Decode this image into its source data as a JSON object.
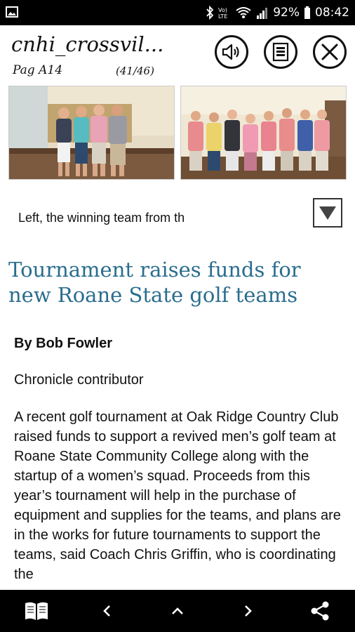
{
  "status_bar": {
    "battery": "92%",
    "time": "08:42",
    "icons": [
      "image-icon",
      "bluetooth-icon",
      "volte-icon",
      "wifi-icon",
      "signal-icon",
      "battery-icon"
    ]
  },
  "header": {
    "title": "cnhi_crossvil...",
    "page_label": "Pag  A14",
    "page_count": "(41/46)",
    "buttons": [
      "speaker-icon",
      "document-icon",
      "close-icon"
    ]
  },
  "caption": {
    "text": "Left, the winning team from th"
  },
  "article": {
    "headline": "Tournament raises funds for new Roane State golf teams",
    "byline": "By Bob Fowler",
    "contributor": "Chronicle contributor",
    "body": "A recent golf tournament at Oak Ridge Country Club raised funds to support a revived men’s golf team at Roane State Community College along with the startup of a women’s squad. Proceeds from this year’s tournament will help in the purchase of equipment and supplies for the teams, and plans are in the works for future tournaments to support the teams, said Coach Chris Griffin, who is coordinating the"
  },
  "bottom_bar": {
    "buttons": [
      "book-icon",
      "prev-icon",
      "up-icon",
      "next-icon",
      "share-icon"
    ]
  },
  "colors": {
    "headline": "#2a6d8e",
    "bars": "#000000"
  }
}
